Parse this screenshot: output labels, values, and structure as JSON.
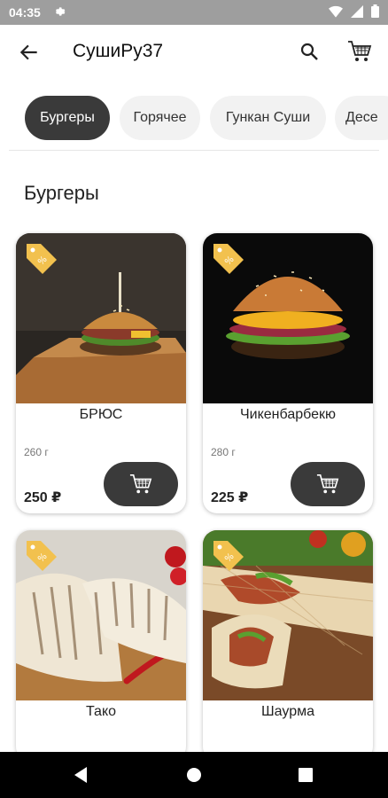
{
  "status_bar": {
    "time": "04:35"
  },
  "app_bar": {
    "title": "СушиРу37"
  },
  "categories": [
    {
      "label": "Бургеры",
      "active": true
    },
    {
      "label": "Горячее",
      "active": false
    },
    {
      "label": "Гункан Суши",
      "active": false
    },
    {
      "label": "Десе",
      "active": false
    }
  ],
  "section": {
    "title": "Бургеры"
  },
  "products": [
    {
      "name": "БРЮС",
      "weight": "260 г",
      "price": "250 ₽",
      "icon": "discount-tag-icon"
    },
    {
      "name": "Чикенбарбекю",
      "weight": "280 г",
      "price": "225 ₽",
      "icon": "discount-tag-icon"
    },
    {
      "name": "Тако",
      "icon": "discount-tag-icon"
    },
    {
      "name": "Шаурма",
      "icon": "discount-tag-icon"
    }
  ],
  "colors": {
    "accent": "#3a3a3a",
    "tag": "#f2c14e",
    "chip_bg": "#f2f2f2",
    "statusbar": "#9e9e9e"
  }
}
